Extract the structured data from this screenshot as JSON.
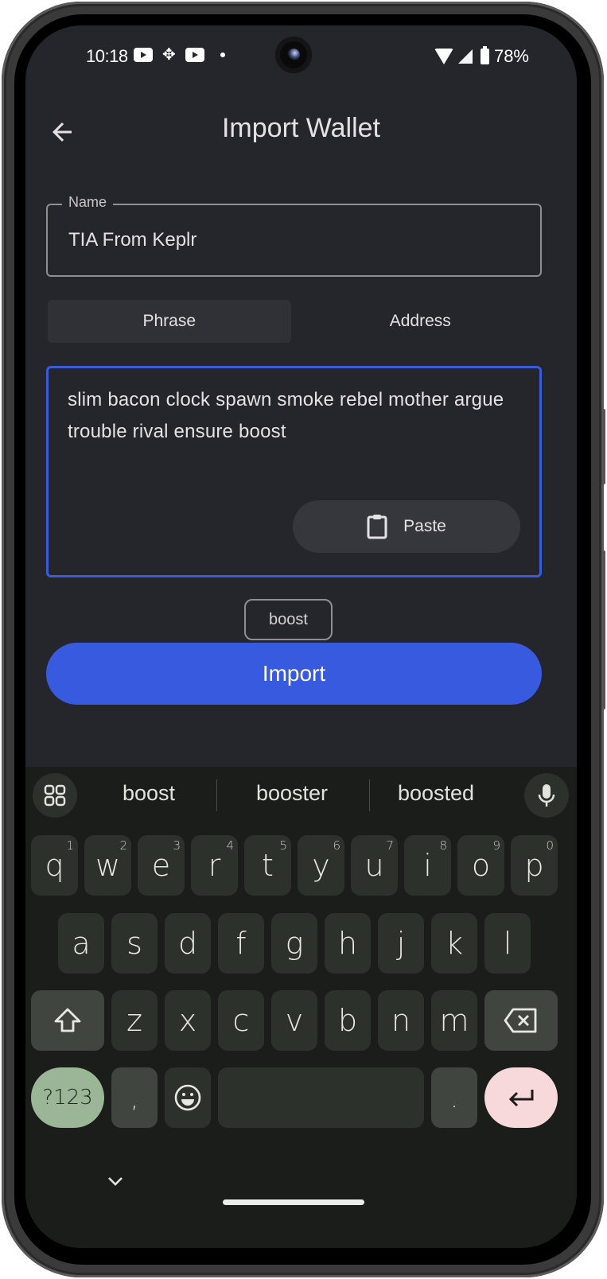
{
  "status_bar": {
    "time": "10:18",
    "left_icons": [
      "youtube-icon",
      "pinwheel-icon",
      "youtube-icon",
      "notification-dot-icon"
    ],
    "right_icons": [
      "wifi-icon",
      "cell-signal-icon",
      "battery-icon"
    ],
    "battery_percent": "78%"
  },
  "app_bar": {
    "back_icon": "arrow-left-icon",
    "title": "Import Wallet"
  },
  "name_field": {
    "label": "Name",
    "value": "TIA From Keplr"
  },
  "tabs": [
    {
      "label": "Phrase",
      "active": true
    },
    {
      "label": "Address",
      "active": false
    }
  ],
  "phrase_input": {
    "value": "slim bacon clock spawn smoke rebel mother argue trouble rival ensure boost",
    "paste_label": "Paste",
    "paste_icon": "clipboard-icon"
  },
  "word_suggestion": "boost",
  "import_button": {
    "label": "Import"
  },
  "colors": {
    "accent": "#385ade",
    "background": "#25262b",
    "keyboard_bg": "#1a1d19",
    "sym_key": "#9bb597",
    "enter_key": "#f7d9dc"
  },
  "keyboard": {
    "suggestions": [
      "boost",
      "booster",
      "boosted"
    ],
    "row1": [
      {
        "key": "q",
        "hint": "1"
      },
      {
        "key": "w",
        "hint": "2"
      },
      {
        "key": "e",
        "hint": "3"
      },
      {
        "key": "r",
        "hint": "4"
      },
      {
        "key": "t",
        "hint": "5"
      },
      {
        "key": "y",
        "hint": "6"
      },
      {
        "key": "u",
        "hint": "7"
      },
      {
        "key": "i",
        "hint": "8"
      },
      {
        "key": "o",
        "hint": "9"
      },
      {
        "key": "p",
        "hint": "0"
      }
    ],
    "row2": [
      "a",
      "s",
      "d",
      "f",
      "g",
      "h",
      "j",
      "k",
      "l"
    ],
    "row3": [
      "z",
      "x",
      "c",
      "v",
      "b",
      "n",
      "m"
    ],
    "symbols_label": "?123",
    "comma": ",",
    "period": "."
  }
}
